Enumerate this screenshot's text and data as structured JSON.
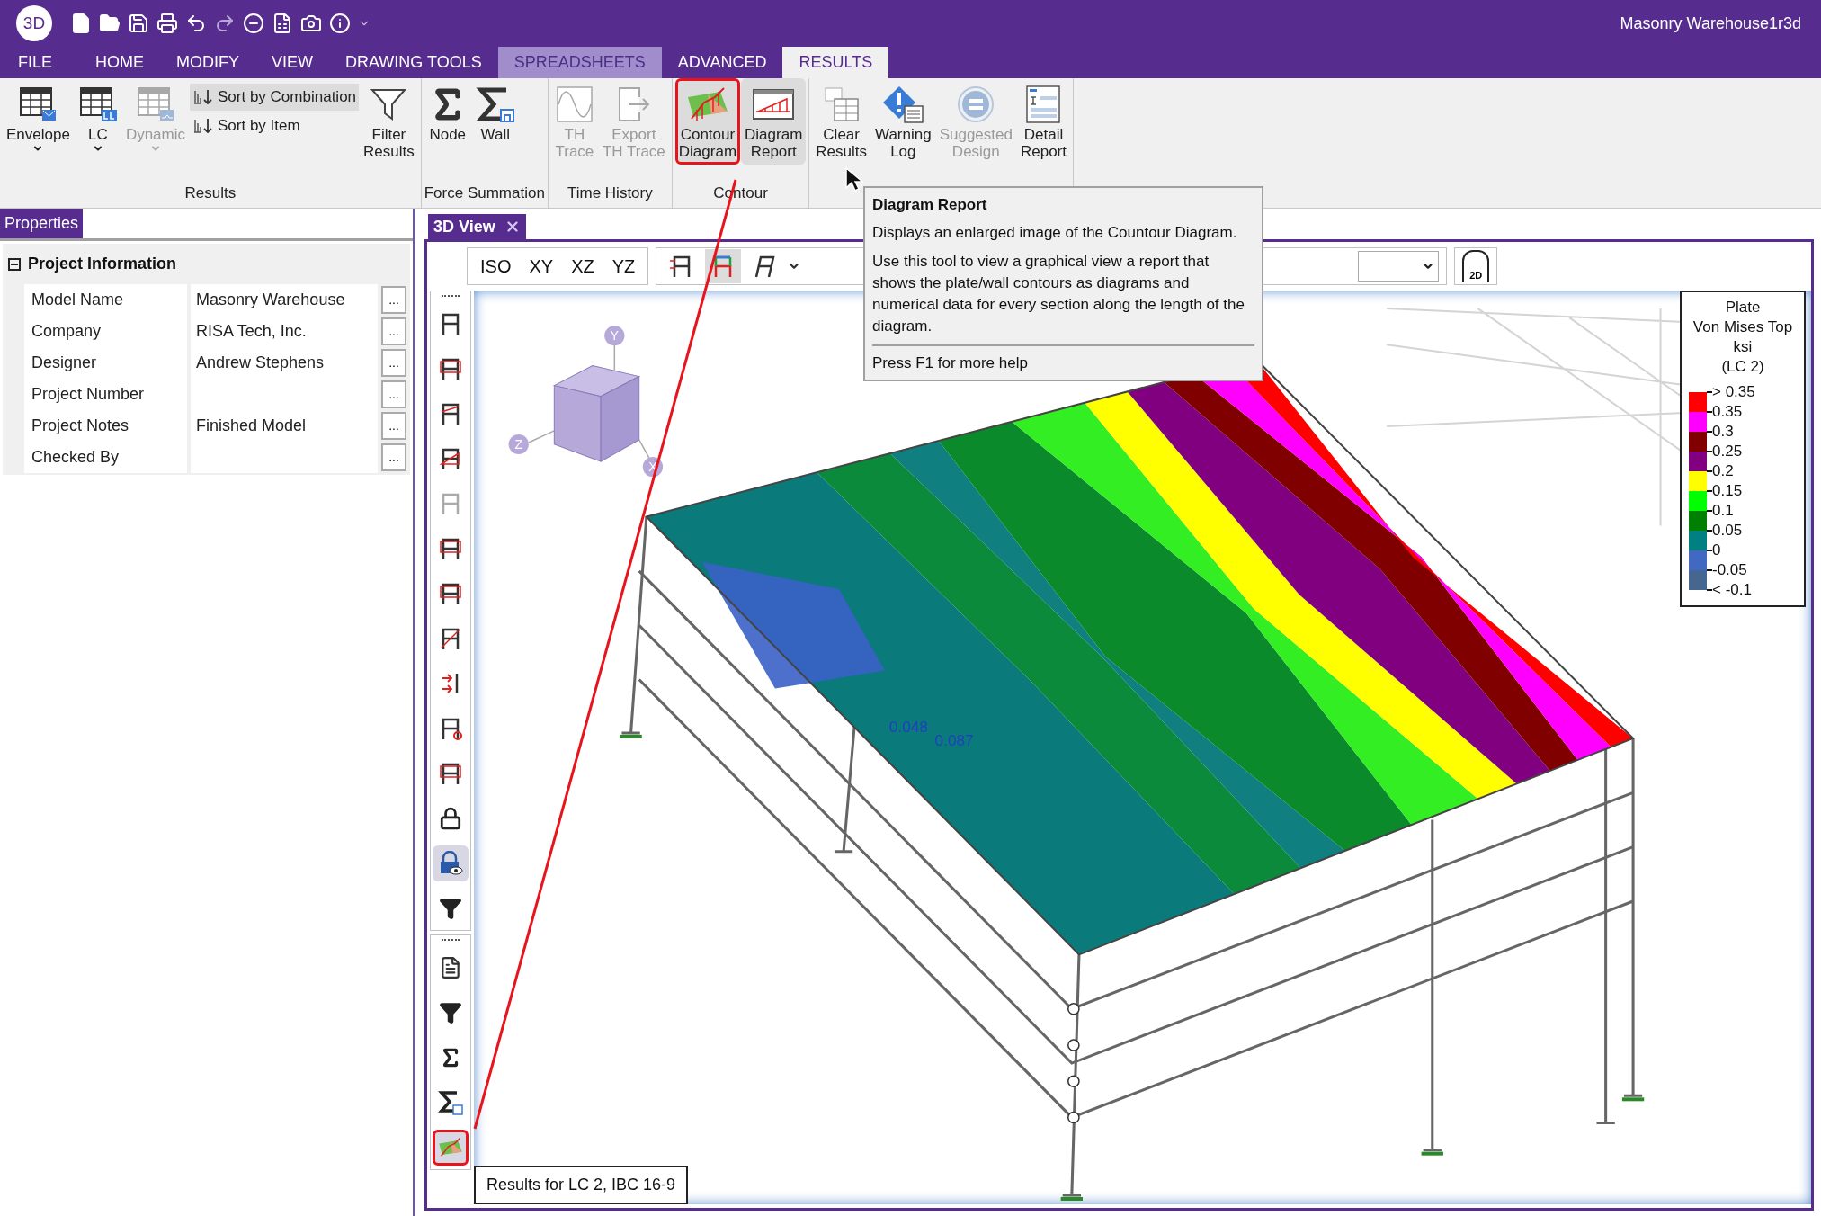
{
  "app": {
    "logo": "3D"
  },
  "window": {
    "title": "Masonry Warehouse1r3d"
  },
  "menu_tabs": [
    {
      "label": "FILE",
      "kind": "normal",
      "selected": false
    },
    {
      "label": "HOME",
      "kind": "normal",
      "selected": false
    },
    {
      "label": "MODIFY",
      "kind": "normal",
      "selected": false
    },
    {
      "label": "VIEW",
      "kind": "normal",
      "selected": false
    },
    {
      "label": "DRAWING TOOLS",
      "kind": "normal",
      "selected": false
    },
    {
      "label": "SPREADSHEETS",
      "kind": "contextual",
      "selected": false
    },
    {
      "label": "ADVANCED",
      "kind": "normal",
      "selected": false
    },
    {
      "label": "RESULTS",
      "kind": "normal",
      "selected": true
    }
  ],
  "ribbon_groups": [
    {
      "label": "Results",
      "buttons": [
        {
          "label": "Envelope",
          "kind": "table-mail",
          "dropdown": true,
          "disabled": false,
          "highlighted": false
        },
        {
          "label": "LC",
          "kind": "table-lc",
          "dropdown": true,
          "disabled": false,
          "highlighted": false
        },
        {
          "label": "Dynamic",
          "kind": "table-wave",
          "dropdown": true,
          "disabled": true,
          "highlighted": false
        },
        {
          "label": "Sort by Combination",
          "kind": "sort",
          "dropdown": false,
          "disabled": false,
          "highlighted": true
        },
        {
          "label": "Sort by Item",
          "kind": "sort",
          "dropdown": false,
          "disabled": false,
          "highlighted": false
        },
        {
          "label": "Filter\nResults",
          "kind": "funnel",
          "dropdown": false,
          "disabled": false,
          "highlighted": false
        }
      ]
    },
    {
      "label": "Force Summation",
      "buttons": [
        {
          "label": "Node",
          "kind": "sigma",
          "dropdown": false,
          "disabled": false,
          "highlighted": false
        },
        {
          "label": "Wall",
          "kind": "sigma-wall",
          "dropdown": false,
          "disabled": false,
          "highlighted": false
        }
      ]
    },
    {
      "label": "Time History",
      "buttons": [
        {
          "label": "TH\nTrace",
          "kind": "wave",
          "dropdown": false,
          "disabled": true,
          "highlighted": false
        },
        {
          "label": "Export\nTH Trace",
          "kind": "export",
          "dropdown": false,
          "disabled": true,
          "highlighted": false
        }
      ]
    },
    {
      "label": "Contour",
      "buttons": [
        {
          "label": "Contour\nDiagram",
          "kind": "contour",
          "dropdown": false,
          "disabled": false,
          "highlighted": true,
          "annotated": true
        },
        {
          "label": "Diagram\nReport",
          "kind": "diagram",
          "dropdown": false,
          "disabled": false,
          "highlighted": true
        }
      ]
    },
    {
      "buttons": [
        {
          "label": "Clear\nResults",
          "kind": "clear",
          "dropdown": false,
          "disabled": false,
          "highlighted": false
        },
        {
          "label": "Warning\nLog",
          "kind": "warning",
          "dropdown": false,
          "disabled": false,
          "highlighted": false
        },
        {
          "label": "Suggested\nDesign",
          "kind": "suggest",
          "dropdown": false,
          "disabled": true,
          "highlighted": false
        },
        {
          "label": "Detail\nReport",
          "kind": "report",
          "dropdown": false,
          "disabled": false,
          "highlighted": false
        }
      ]
    }
  ],
  "properties": {
    "tab": "Properties",
    "section": {
      "title": "Project Information",
      "expanded": true,
      "rows": [
        {
          "label": "Model Name",
          "value": "Masonry Warehouse",
          "button": "..."
        },
        {
          "label": "Company",
          "value": "RISA Tech, Inc.",
          "button": "..."
        },
        {
          "label": "Designer",
          "value": "Andrew Stephens",
          "button": "..."
        },
        {
          "label": "Project Number",
          "value": "",
          "button": "..."
        },
        {
          "label": "Project Notes",
          "value": "Finished Model",
          "button": "..."
        },
        {
          "label": "Checked By",
          "value": "",
          "button": "..."
        }
      ]
    }
  },
  "view": {
    "tab": {
      "label": "3D View",
      "selected": true
    },
    "view_buttons": [
      {
        "label": "ISO"
      },
      {
        "label": "XY"
      },
      {
        "label": "XZ"
      },
      {
        "label": "YZ"
      }
    ],
    "tool_buttons": [
      {
        "kind": "frame-arrows",
        "selected": false
      },
      {
        "kind": "frame-color",
        "selected": true
      },
      {
        "kind": "frame-italic",
        "selected": false
      }
    ],
    "lock_label": "2D",
    "side_tool_groups": [
      [
        {
          "kind": "frame",
          "selected": false
        },
        {
          "kind": "frame-box",
          "selected": false
        },
        {
          "kind": "frame-skew",
          "selected": false
        },
        {
          "kind": "frame-moment",
          "selected": false
        },
        {
          "kind": "frame-faded",
          "selected": false
        },
        {
          "kind": "frame-box",
          "selected": false
        },
        {
          "kind": "frame-box",
          "selected": false
        },
        {
          "kind": "frame-slash",
          "selected": false
        },
        {
          "kind": "arrows",
          "selected": false
        },
        {
          "kind": "frame-gear",
          "selected": false
        },
        {
          "kind": "frame-box",
          "selected": false
        },
        {
          "kind": "lock",
          "selected": false
        },
        {
          "kind": "lock-eye",
          "selected": true
        },
        {
          "kind": "filter",
          "selected": false
        }
      ],
      [
        {
          "kind": "report",
          "selected": false
        },
        {
          "kind": "filter",
          "selected": false
        },
        {
          "kind": "sigma",
          "selected": false
        },
        {
          "kind": "sigma-wall",
          "selected": false
        },
        {
          "kind": "contour",
          "selected": true,
          "annotated": true
        }
      ]
    ],
    "axes": [
      "Y",
      "Z",
      "X"
    ],
    "plot_labels": [
      "0.048",
      "0.087"
    ],
    "legend": {
      "title": [
        "Plate",
        "Von Mises Top",
        "ksi",
        "(LC 2)"
      ],
      "ticks": [
        "> 0.35",
        "0.35",
        "0.3",
        "0.25",
        "0.2",
        "0.15",
        "0.1",
        "0.05",
        "0",
        "-0.05",
        "< -0.1"
      ],
      "bands": [
        {
          "color": "#ff0000"
        },
        {
          "color": "#ff00ff"
        },
        {
          "color": "#800000"
        },
        {
          "color": "#800080"
        },
        {
          "color": "#ffff00"
        },
        {
          "color": "#00ff00"
        },
        {
          "color": "#008000"
        },
        {
          "color": "#008080"
        },
        {
          "color": "#4169c1"
        },
        {
          "color": "#466690"
        }
      ]
    },
    "status_tip": "Results for LC 2, IBC 16-9"
  },
  "tooltip": {
    "title": "Diagram Report",
    "paragraphs": [
      "Displays an enlarged image of the Countour Diagram.",
      "Use this tool to view a graphical view a report that shows the plate/wall contours as diagrams and numerical data for every section along the length of the diagram."
    ],
    "footer": "Press F1 for more help"
  }
}
